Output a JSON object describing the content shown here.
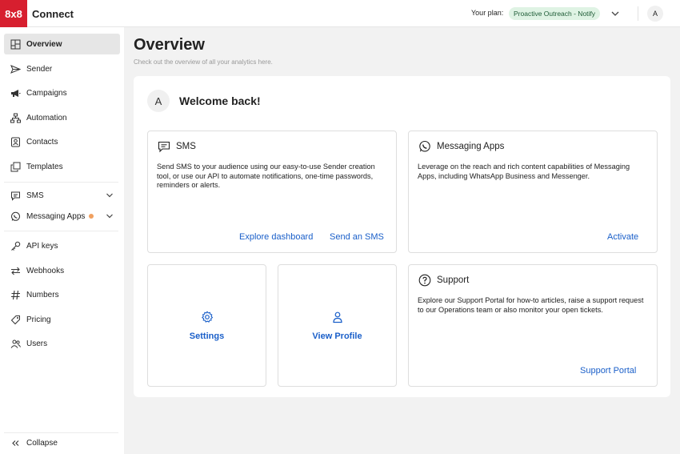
{
  "header": {
    "logo_text": "8x8",
    "app_name": "Connect",
    "plan_label": "Your plan:",
    "plan_value": "Proactive Outreach - Notify",
    "avatar_initial": "A"
  },
  "sidebar": {
    "items": [
      {
        "label": "Overview",
        "icon": "dashboard-icon"
      },
      {
        "label": "Sender",
        "icon": "send-icon"
      },
      {
        "label": "Campaigns",
        "icon": "megaphone-icon"
      },
      {
        "label": "Automation",
        "icon": "flow-icon"
      },
      {
        "label": "Contacts",
        "icon": "contact-card-icon"
      },
      {
        "label": "Templates",
        "icon": "templates-icon"
      },
      {
        "label": "SMS",
        "icon": "chat-bubble-icon"
      },
      {
        "label": "Messaging Apps",
        "icon": "whatsapp-icon"
      },
      {
        "label": "API keys",
        "icon": "key-icon"
      },
      {
        "label": "Webhooks",
        "icon": "arrows-icon"
      },
      {
        "label": "Numbers",
        "icon": "hash-icon"
      },
      {
        "label": "Pricing",
        "icon": "tag-icon"
      },
      {
        "label": "Users",
        "icon": "users-icon"
      }
    ],
    "collapse_label": "Collapse"
  },
  "main": {
    "title": "Overview",
    "subtitle": "Check out the overview of all your analytics here.",
    "welcome_initial": "A",
    "welcome_text": "Welcome back!",
    "sms_card": {
      "title": "SMS",
      "body": "Send SMS to your audience using our easy-to-use Sender creation tool, or use our API to automate notifications, one-time passwords, reminders or alerts.",
      "link1": "Explore dashboard",
      "link2": "Send an SMS"
    },
    "apps_card": {
      "title": "Messaging Apps",
      "body": "Leverage on the reach and rich content capabilities of Messaging Apps, including WhatsApp Business and Messenger.",
      "link": "Activate"
    },
    "settings_tile": {
      "label": "Settings"
    },
    "profile_tile": {
      "label": "View Profile"
    },
    "support_card": {
      "title": "Support",
      "body": "Explore our Support Portal for how-to articles, raise a support request to our Operations team or also monitor your open tickets.",
      "link": "Support Portal"
    }
  },
  "colors": {
    "brand": "#d71f2f",
    "link": "#1a5fc9",
    "plan_badge_bg": "#dff3e4",
    "notification_dot": "#f0a060"
  }
}
